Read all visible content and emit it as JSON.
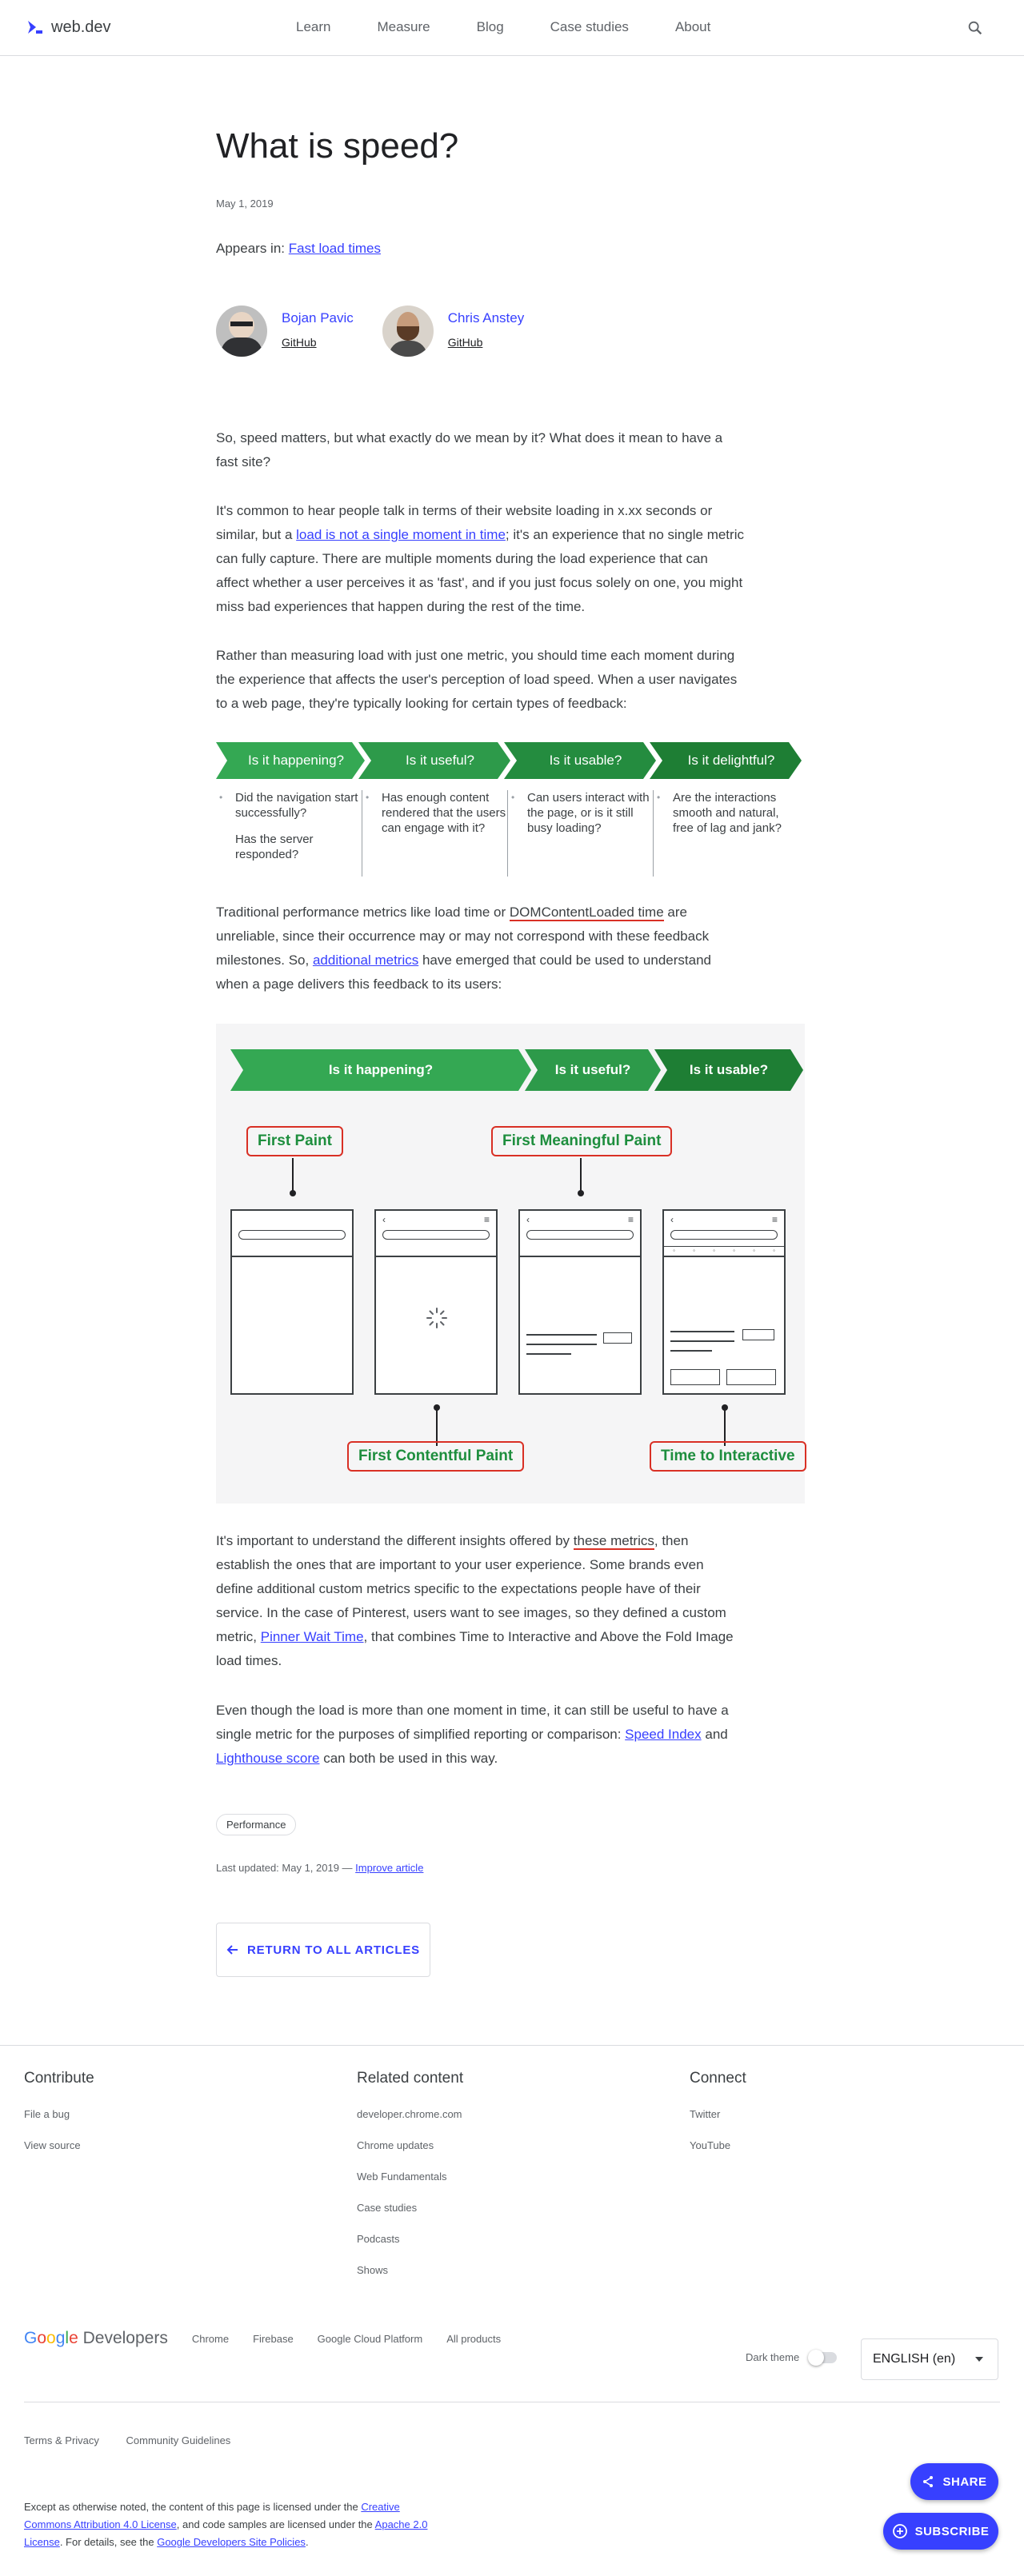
{
  "header": {
    "logo_text": "web.dev",
    "nav": [
      "Learn",
      "Measure",
      "Blog",
      "Case studies",
      "About"
    ]
  },
  "article": {
    "title": "What is speed?",
    "date": "May 1, 2019",
    "appears_prefix": "Appears in: ",
    "appears_link": "Fast load times",
    "authors": [
      {
        "name": "Bojan Pavic",
        "link": "GitHub"
      },
      {
        "name": "Chris Anstey",
        "link": "GitHub"
      }
    ],
    "p1": "So, speed matters, but what exactly do we mean by it? What does it mean to have a fast site?",
    "p2_a": "It's common to hear people talk in terms of their website loading in x.xx seconds or similar, but a ",
    "p2_link": "load is not a single moment in time",
    "p2_b": "; it's an experience that no single metric can fully capture. There are multiple moments during the load experience that can affect whether a user perceives it as 'fast', and if you just focus solely on one, you might miss bad experiences that happen during the rest of the time.",
    "p3": "Rather than measuring load with just one metric, you should time each moment during the experience that affects the user's perception of load speed. When a user navigates to a web page, they're typically looking for certain types of feedback:",
    "flow": [
      {
        "label": "Is it happening?",
        "items": [
          "Did the navigation start successfully?",
          "Has the server responded?"
        ]
      },
      {
        "label": "Is it useful?",
        "items": [
          "Has enough content rendered that the users can engage with it?"
        ]
      },
      {
        "label": "Is it usable?",
        "items": [
          "Can users interact with the page, or is it still busy loading?"
        ]
      },
      {
        "label": "Is it delightful?",
        "items": [
          "Are the interactions smooth and natural, free of lag and jank?"
        ]
      }
    ],
    "p4_a": "Traditional performance metrics like load time or ",
    "p4_hl": "DOMContentLoaded time",
    "p4_b": " are unreliable, since their occurrence may or may not correspond with these feedback milestones. So, ",
    "p4_link": "additional metrics",
    "p4_c": " have emerged that could be used to understand when a page delivers this feedback to its users:",
    "diagram": {
      "stages": [
        "Is it happening?",
        "Is it useful?",
        "Is it usable?"
      ],
      "labels": {
        "first_paint": "First Paint",
        "first_meaningful_paint": "First Meaningful Paint",
        "first_contentful_paint": "First Contentful Paint",
        "time_to_interactive": "Time to Interactive"
      }
    },
    "p5_a": "It's important to understand the different insights offered by ",
    "p5_hl": "these metrics",
    "p5_b": ", then establish the ones that are important to your user experience. Some brands even define additional custom metrics specific to the expectations people have of their service. In the case of Pinterest, users want to see images, so they defined a custom metric, ",
    "p5_link": "Pinner Wait Time",
    "p5_c": ", that combines Time to Interactive and Above the Fold Image load times.",
    "p6_a": "Even though the load is more than one moment in time, it can still be useful to have a single metric for the purposes of simplified reporting or comparison: ",
    "p6_link1": "Speed Index",
    "p6_b": " and ",
    "p6_link2": "Lighthouse score",
    "p6_c": " can both be used in this way.",
    "tag": "Performance",
    "updated_prefix": "Last updated: May 1, 2019 — ",
    "updated_link": "Improve article",
    "return_label": "RETURN TO ALL ARTICLES"
  },
  "footer": {
    "columns": [
      {
        "title": "Contribute",
        "items": [
          "File a bug",
          "View source"
        ]
      },
      {
        "title": "Related content",
        "items": [
          "developer.chrome.com",
          "Chrome updates",
          "Web Fundamentals",
          "Case studies",
          "Podcasts",
          "Shows"
        ]
      },
      {
        "title": "Connect",
        "items": [
          "Twitter",
          "YouTube"
        ]
      }
    ],
    "gdev_word": "Developers",
    "gdev_links": [
      "Chrome",
      "Firebase",
      "Google Cloud Platform",
      "All products"
    ],
    "dark_theme": "Dark theme",
    "language": "ENGLISH (en)",
    "terms": [
      "Terms & Privacy",
      "Community Guidelines"
    ],
    "license_a": "Except as otherwise noted, the content of this page is licensed under the ",
    "license_link1": "Creative Commons Attribution 4.0 License",
    "license_b": ", and code samples are licensed under the ",
    "license_link2": "Apache 2.0 License",
    "license_c": ". For details, see the ",
    "license_link3": "Google Developers Site Policies",
    "license_d": ".",
    "share": "SHARE",
    "subscribe": "SUBSCRIBE"
  },
  "colors": {
    "accent": "#3740ff",
    "green1": "#34a853",
    "green2": "#2d9a4a",
    "green3": "#248c3f",
    "green4": "#1e7e34",
    "highlight_red": "#d93025"
  }
}
